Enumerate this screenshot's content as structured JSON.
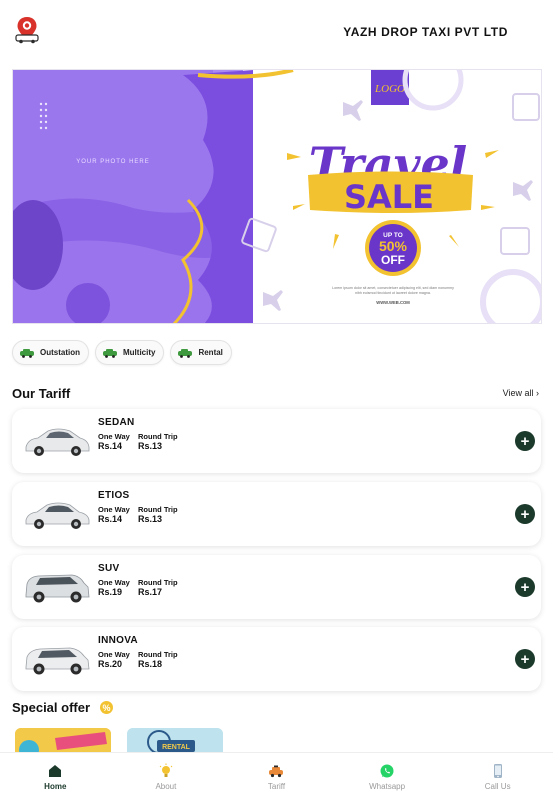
{
  "header": {
    "company_name": "YAZH DROP TAXI PVT LTD",
    "logo_icon": "location-pin-car-logo"
  },
  "banner": {
    "photo_placeholder": "YOUR PHOTO HERE",
    "logo_text": "LOGO",
    "headline": "Travel",
    "subheadline": "SALE",
    "discount_top": "UP TO",
    "discount_value": "50%",
    "discount_bottom": "OFF",
    "lorem_line1": "Lorem ipsum dolor sit amet, consectetuer adipiscing elit, sed diam nonummy",
    "lorem_line2": "nibh euismod tincidunt ut laoreet dolore magna.",
    "website": "WWW.WEB.COM"
  },
  "chips": [
    {
      "label": "Outstation",
      "icon": "taxi-icon"
    },
    {
      "label": "Multicity",
      "icon": "taxi-icon"
    },
    {
      "label": "Rental",
      "icon": "taxi-icon"
    }
  ],
  "tariff": {
    "title": "Our Tariff",
    "view_all": "View all",
    "one_way_label": "One Way",
    "round_trip_label": "Round Trip",
    "cars": [
      {
        "name": "SEDAN",
        "one_way": "Rs.14",
        "round_trip": "Rs.13",
        "color": "#e8e9ea"
      },
      {
        "name": "ETIOS",
        "one_way": "Rs.14",
        "round_trip": "Rs.13",
        "color": "#e9eaeb"
      },
      {
        "name": "SUV",
        "one_way": "Rs.19",
        "round_trip": "Rs.17",
        "color": "#dcdfe2"
      },
      {
        "name": "INNOVA",
        "one_way": "Rs.20",
        "round_trip": "Rs.18",
        "color": "#ecedee"
      }
    ]
  },
  "special_offer": {
    "title": "Special offer",
    "badge": "%",
    "cards": [
      {
        "label": "",
        "color": "#f3c94a"
      },
      {
        "label": "RENTAL",
        "color": "#bfe3ee"
      }
    ]
  },
  "bottom_nav": [
    {
      "label": "Home",
      "icon": "home-icon",
      "active": true
    },
    {
      "label": "About",
      "icon": "lightbulb-icon",
      "active": false
    },
    {
      "label": "Tariff",
      "icon": "taxi-icon",
      "active": false
    },
    {
      "label": "Whatsapp",
      "icon": "whatsapp-icon",
      "active": false
    },
    {
      "label": "Call Us",
      "icon": "phone-icon",
      "active": false
    }
  ],
  "colors": {
    "accent": "#1c3a2c",
    "banner_purple": "#8b5cf6",
    "banner_yellow": "#f2c230"
  }
}
